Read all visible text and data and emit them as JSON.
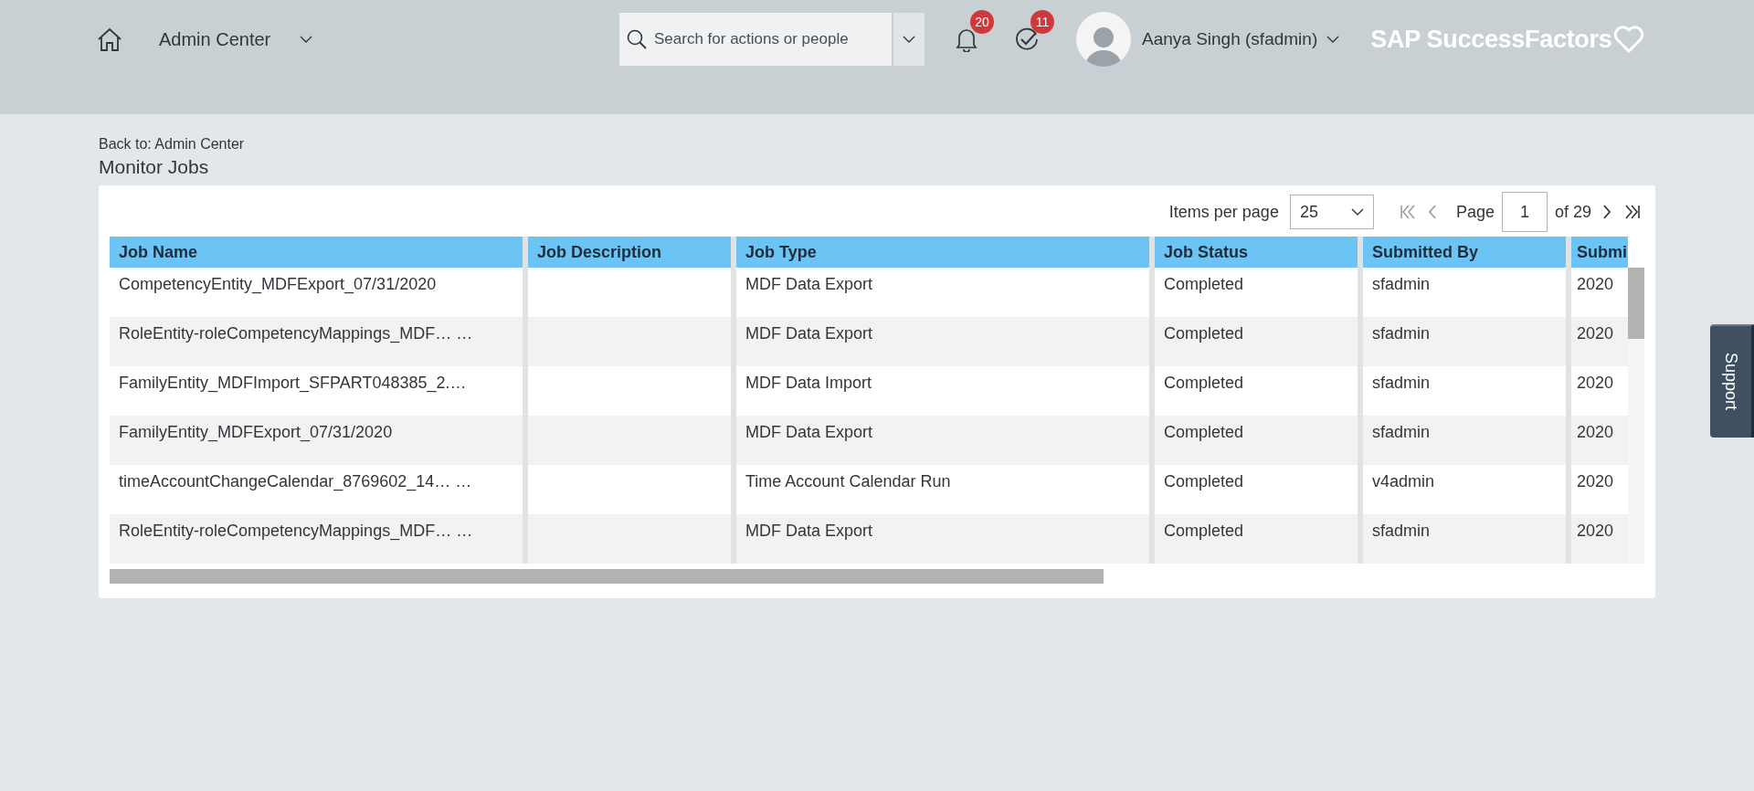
{
  "header": {
    "nav_title": "Admin Center",
    "search": {
      "placeholder": "Search for actions or people"
    },
    "notifications": {
      "count": "20"
    },
    "todos": {
      "count": "11"
    },
    "user": {
      "name": "Aanya Singh (sfadmin)"
    },
    "logo": {
      "text": "SAP SuccessFactors"
    }
  },
  "breadcrumb": "Back to: Admin Center",
  "page_title": "Monitor Jobs",
  "pager": {
    "items_label": "Items per page",
    "items_value": "25",
    "page_label": "Page",
    "page_value": "1",
    "page_total": "of 29",
    "nav_buttons": [
      {
        "kind": "first",
        "disabled": true
      },
      {
        "kind": "prev",
        "disabled": true
      },
      {
        "kind": "next",
        "disabled": false
      },
      {
        "kind": "last",
        "disabled": false
      }
    ]
  },
  "table": {
    "columns": [
      "Job Name",
      "Job Description",
      "Job Type",
      "Job Status",
      "Submitted By",
      "Submi"
    ],
    "rows": [
      [
        "CompetencyEntity_MDFExport_07/31/2020",
        "",
        "MDF Data Export",
        "Completed",
        "sfadmin",
        "2020"
      ],
      [
        "RoleEntity-roleCompetencyMappings_MDF… …",
        "",
        "MDF Data Export",
        "Completed",
        "sfadmin",
        "2020"
      ],
      [
        "FamilyEntity_MDFImport_SFPART048385_2.…",
        "",
        "MDF Data Import",
        "Completed",
        "sfadmin",
        "2020"
      ],
      [
        "FamilyEntity_MDFExport_07/31/2020",
        "",
        "MDF Data Export",
        "Completed",
        "sfadmin",
        "2020"
      ],
      [
        "timeAccountChangeCalendar_8769602_14… …",
        "",
        "Time Account Calendar Run",
        "Completed",
        "v4admin",
        "2020"
      ],
      [
        "RoleEntity-roleCompetencyMappings_MDF… …",
        "",
        "MDF Data Export",
        "Completed",
        "sfadmin",
        "2020"
      ]
    ]
  },
  "support_tab": "Support"
}
